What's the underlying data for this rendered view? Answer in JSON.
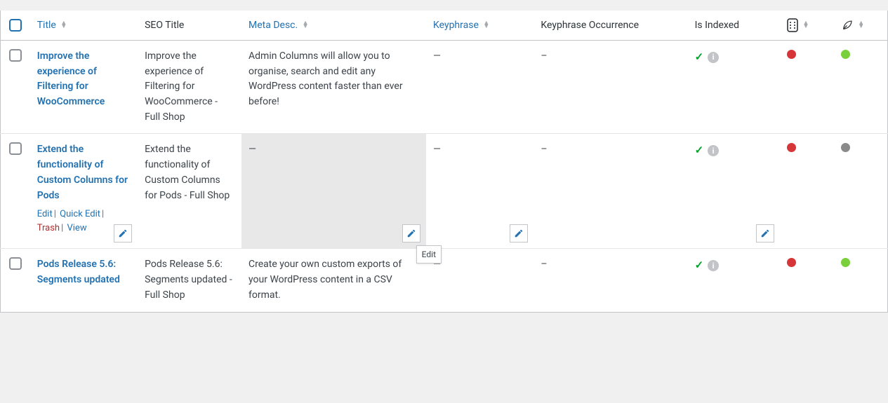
{
  "columns": {
    "title": "Title",
    "seo_title": "SEO Title",
    "meta_desc": "Meta Desc.",
    "keyphrase": "Keyphrase",
    "keyphrase_occurrence": "Keyphrase Occurrence",
    "is_indexed": "Is Indexed"
  },
  "row_actions": {
    "edit": "Edit",
    "quick_edit": "Quick Edit",
    "trash": "Trash",
    "view": "View"
  },
  "tooltip": {
    "edit": "Edit"
  },
  "dash": "—",
  "endash": "–",
  "rows": [
    {
      "title": "Improve the experience of Filtering for WooCommerce",
      "seo_title": "Improve the experience of Filtering for WooCommerce - Full Shop",
      "meta_desc": "Admin Columns will allow you to organise, search and edit any WordPress content faster than ever before!",
      "keyphrase": "—",
      "occurrence": "–",
      "indexed": true,
      "readability": "red",
      "seo_score": "green"
    },
    {
      "title": "Extend the functionality of Custom Columns for Pods",
      "seo_title": "Extend the functionality of Custom Columns for Pods - Full Shop",
      "meta_desc": "—",
      "keyphrase": "—",
      "occurrence": "–",
      "indexed": true,
      "readability": "red",
      "seo_score": "grey"
    },
    {
      "title": "Pods Release 5.6: Segments updated",
      "seo_title": "Pods Release 5.6: Segments updated - Full Shop",
      "meta_desc": "Create your own custom exports of your WordPress content in a CSV format.",
      "keyphrase": "—",
      "occurrence": "–",
      "indexed": true,
      "readability": "red",
      "seo_score": "green"
    }
  ]
}
